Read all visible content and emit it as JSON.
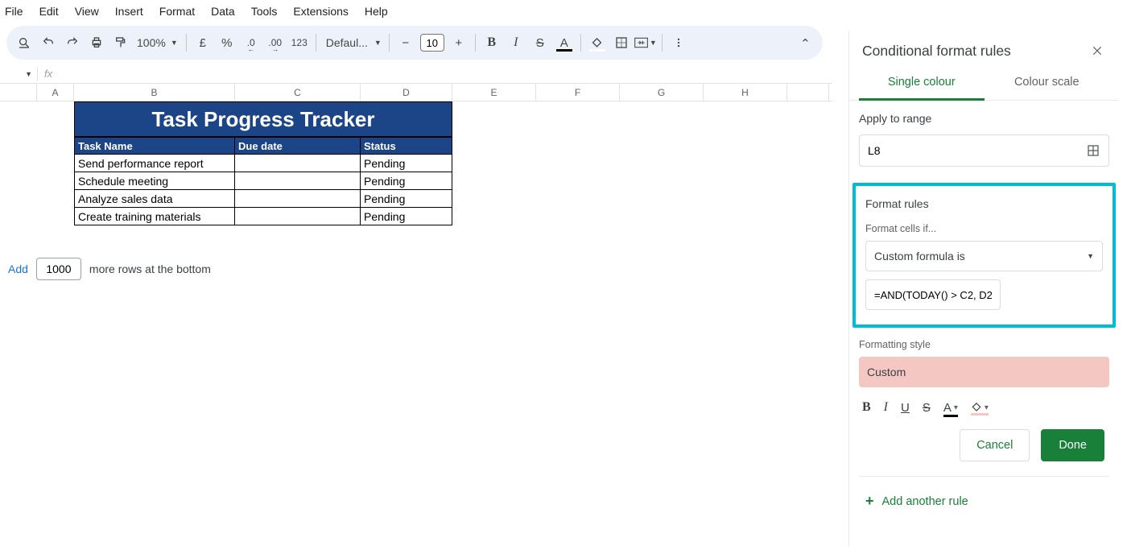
{
  "menu": [
    "File",
    "Edit",
    "View",
    "Insert",
    "Format",
    "Data",
    "Tools",
    "Extensions",
    "Help"
  ],
  "toolbar": {
    "zoom": "100%",
    "currency": "£",
    "percent": "%",
    "dec_dec": ".0",
    "dec_inc": ".00",
    "num123": "123",
    "font": "Defaul...",
    "size": "10",
    "bold": "B",
    "italic": "I",
    "strike": "S"
  },
  "formula_bar": {
    "fx": "fx"
  },
  "columns": [
    "A",
    "B",
    "C",
    "D",
    "E",
    "F",
    "G",
    "H"
  ],
  "sheet": {
    "title": "Task Progress Tracker",
    "headers": {
      "b": "Task Name",
      "c": "Due date",
      "d": "Status"
    },
    "rows": [
      {
        "b": "Send performance report",
        "c": "",
        "d": "Pending"
      },
      {
        "b": "Schedule meeting",
        "c": "",
        "d": "Pending"
      },
      {
        "b": "Analyze sales data",
        "c": "",
        "d": "Pending"
      },
      {
        "b": "Create training materials",
        "c": "",
        "d": "Pending"
      }
    ]
  },
  "add_rows": {
    "link": "Add",
    "count": "1000",
    "suffix": "more rows at the bottom"
  },
  "panel": {
    "title": "Conditional format rules",
    "tab_single": "Single colour",
    "tab_scale": "Colour scale",
    "apply_label": "Apply to range",
    "range_value": "L8",
    "rules_label": "Format rules",
    "cells_if": "Format cells if...",
    "condition": "Custom formula is",
    "formula": "=AND(TODAY() > C2, D2",
    "style_label": "Formatting style",
    "style_name": "Custom",
    "cancel": "Cancel",
    "done": "Done",
    "add_rule": "Add another rule"
  }
}
